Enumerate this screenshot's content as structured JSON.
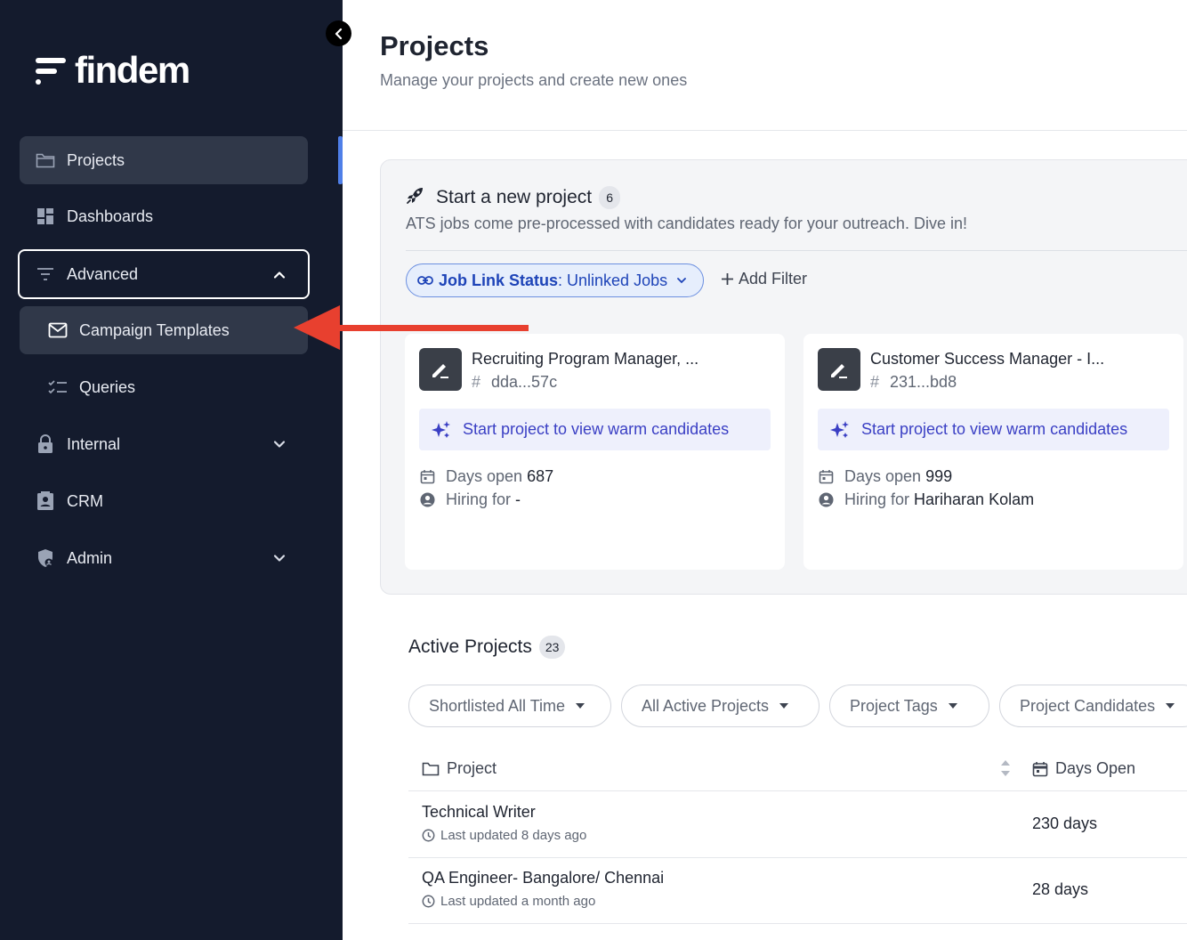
{
  "sidebar": {
    "logo_text": "findem",
    "items": [
      {
        "label": "Projects",
        "icon": "folder-icon"
      },
      {
        "label": "Dashboards",
        "icon": "dashboard-icon"
      },
      {
        "label": "Advanced",
        "icon": "filter-icon"
      },
      {
        "label": "Campaign Templates",
        "icon": "mail-icon"
      },
      {
        "label": "Queries",
        "icon": "checklist-icon"
      },
      {
        "label": "Internal",
        "icon": "lock-icon"
      },
      {
        "label": "CRM",
        "icon": "contact-card-icon"
      },
      {
        "label": "Admin",
        "icon": "shield-user-icon"
      }
    ]
  },
  "header": {
    "title": "Projects",
    "subtitle": "Manage your projects and create new ones"
  },
  "new_project": {
    "title": "Start a new project",
    "count": "6",
    "subtitle": "ATS jobs come pre-processed with candidates ready for your outreach. Dive in!",
    "filter_key": "Job Link Status",
    "filter_sep": ":",
    "filter_value": " Unlinked Jobs",
    "add_filter": "Add Filter",
    "cards": [
      {
        "title": "Recruiting Program Manager, ...",
        "id": "dda...57c",
        "cta": "Start project to view warm candidates",
        "days_label": "Days open",
        "days_value": "687",
        "hiring_label": "Hiring for",
        "hiring_value": "-"
      },
      {
        "title": "Customer Success Manager - I...",
        "id": "231...bd8",
        "cta": "Start project to view warm candidates",
        "days_label": "Days open",
        "days_value": "999",
        "hiring_label": "Hiring for",
        "hiring_value": "Hariharan Kolam"
      }
    ]
  },
  "active_projects": {
    "title": "Active Projects",
    "count": "23",
    "dropdowns": [
      "Shortlisted All Time",
      "All Active Projects",
      "Project Tags",
      "Project Candidates"
    ],
    "columns": [
      "Project",
      "Days Open"
    ],
    "rows": [
      {
        "name": "Technical Writer",
        "updated": "Last updated 8 days ago",
        "days": "230 days"
      },
      {
        "name": "QA Engineer- Bangalore/ Chennai",
        "updated": "Last updated a month ago",
        "days": "28 days"
      }
    ]
  },
  "colors": {
    "sidebar_bg": "#141b2d",
    "sidebar_active": "#303849",
    "accent_blue": "#1e44b8",
    "cta_purple": "#3a3fc4",
    "annotation_arrow": "#e8402f"
  }
}
